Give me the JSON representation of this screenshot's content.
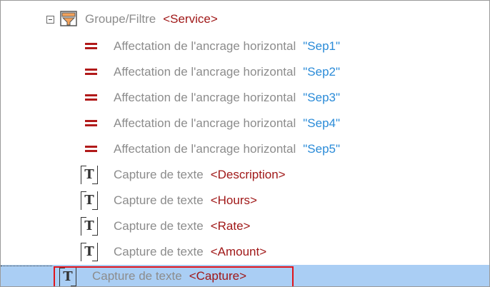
{
  "tree": {
    "group": {
      "label": "Groupe/Filtre",
      "value": "<Service>"
    },
    "anchors": [
      {
        "label": "Affectation de l'ancrage horizontal",
        "value": "\"Sep1\""
      },
      {
        "label": "Affectation de l'ancrage horizontal",
        "value": "\"Sep2\""
      },
      {
        "label": "Affectation de l'ancrage horizontal",
        "value": "\"Sep3\""
      },
      {
        "label": "Affectation de l'ancrage horizontal",
        "value": "\"Sep4\""
      },
      {
        "label": "Affectation de l'ancrage horizontal",
        "value": "\"Sep5\""
      }
    ],
    "captures": [
      {
        "label": "Capture de texte",
        "value": "<Description>"
      },
      {
        "label": "Capture de texte",
        "value": "<Hours>"
      },
      {
        "label": "Capture de texte",
        "value": "<Rate>"
      },
      {
        "label": "Capture de texte",
        "value": "<Amount>"
      }
    ],
    "selected": {
      "label": "Capture de texte",
      "value": "<Capture>"
    }
  },
  "icons": {
    "group": "filter-icon",
    "anchor": "equals-icon",
    "capture": "text-capture-icon",
    "expander": "collapse-icon"
  },
  "colors": {
    "selection": "#aacef4",
    "selection_border": "#e0141b",
    "tag_value": "#a01818",
    "string_value": "#2a8bd8",
    "label": "#8c8c8c"
  }
}
